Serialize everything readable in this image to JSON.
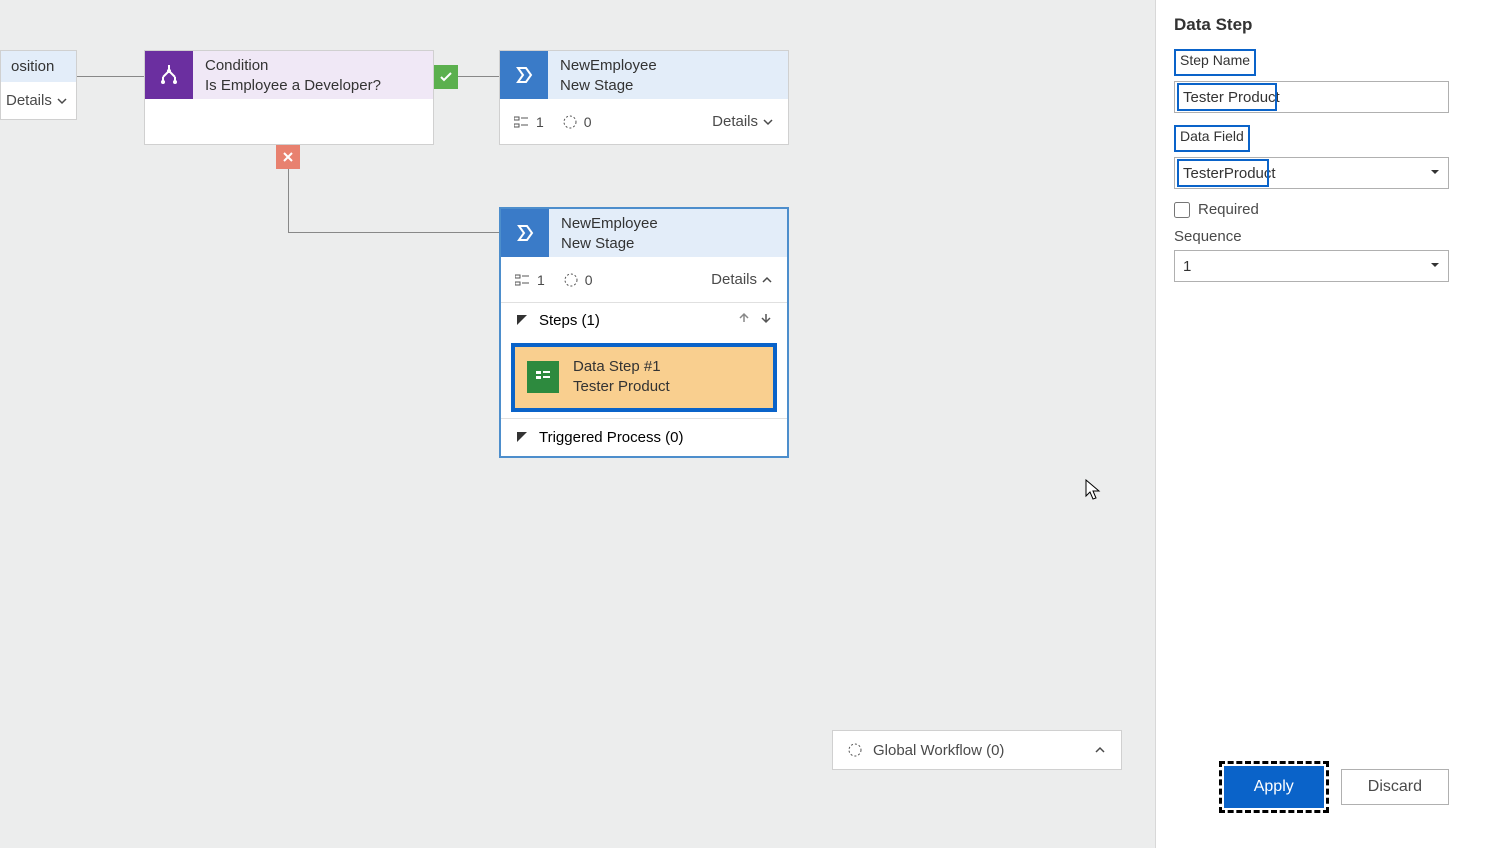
{
  "canvas": {
    "partialNode": {
      "title": "osition",
      "detailsLabel": "Details"
    },
    "conditionNode": {
      "title": "Condition",
      "subtitle": "Is Employee a Developer?"
    },
    "stageTop": {
      "title": "NewEmployee",
      "subtitle": "New Stage",
      "count1": "1",
      "count2": "0",
      "detailsLabel": "Details"
    },
    "stageBottom": {
      "title": "NewEmployee",
      "subtitle": "New Stage",
      "count1": "1",
      "count2": "0",
      "detailsLabel": "Details",
      "stepsHeader": "Steps (1)",
      "step": {
        "title": "Data Step #1",
        "subtitle": "Tester Product"
      },
      "triggeredHeader": "Triggered Process (0)"
    },
    "globalWorkflow": "Global Workflow (0)"
  },
  "panel": {
    "title": "Data Step",
    "stepNameLabel": "Step Name",
    "stepNameValue": "Tester Product",
    "dataFieldLabel": "Data Field",
    "dataFieldValue": "TesterProduct",
    "requiredLabel": "Required",
    "sequenceLabel": "Sequence",
    "sequenceValue": "1",
    "applyLabel": "Apply",
    "discardLabel": "Discard"
  }
}
